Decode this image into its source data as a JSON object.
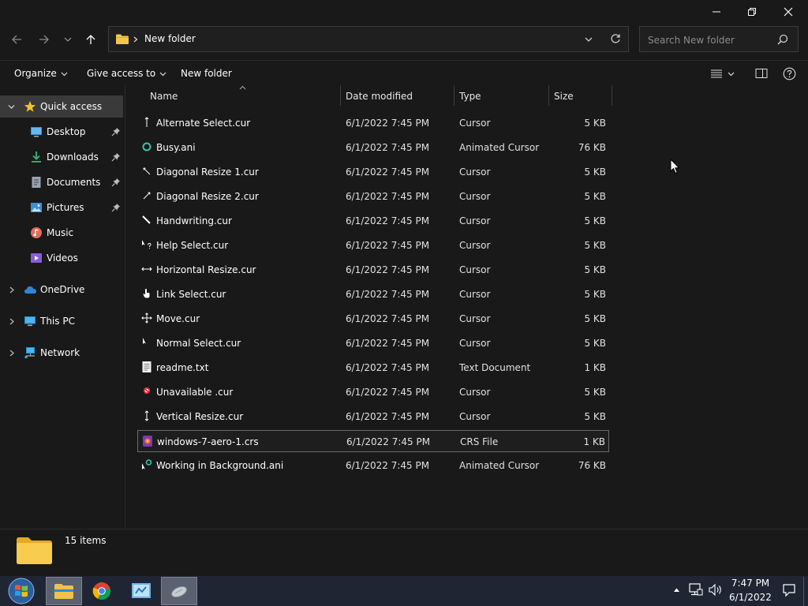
{
  "address": {
    "path": "New folder"
  },
  "search": {
    "placeholder": "Search New folder"
  },
  "commands": {
    "organize": "Organize",
    "give_access": "Give access to",
    "new_folder": "New folder"
  },
  "nav": {
    "quick_access": "Quick access",
    "items": [
      "Desktop",
      "Downloads",
      "Documents",
      "Pictures",
      "Music",
      "Videos"
    ],
    "onedrive": "OneDrive",
    "thispc": "This PC",
    "network": "Network"
  },
  "columns": {
    "name": "Name",
    "date": "Date modified",
    "type": "Type",
    "size": "Size"
  },
  "files": [
    {
      "name": "Alternate Select.cur",
      "date": "6/1/2022 7:45 PM",
      "type": "Cursor",
      "size": "5 KB"
    },
    {
      "name": "Busy.ani",
      "date": "6/1/2022 7:45 PM",
      "type": "Animated Cursor",
      "size": "76 KB"
    },
    {
      "name": "Diagonal Resize 1.cur",
      "date": "6/1/2022 7:45 PM",
      "type": "Cursor",
      "size": "5 KB"
    },
    {
      "name": "Diagonal Resize 2.cur",
      "date": "6/1/2022 7:45 PM",
      "type": "Cursor",
      "size": "5 KB"
    },
    {
      "name": "Handwriting.cur",
      "date": "6/1/2022 7:45 PM",
      "type": "Cursor",
      "size": "5 KB"
    },
    {
      "name": "Help Select.cur",
      "date": "6/1/2022 7:45 PM",
      "type": "Cursor",
      "size": "5 KB"
    },
    {
      "name": "Horizontal Resize.cur",
      "date": "6/1/2022 7:45 PM",
      "type": "Cursor",
      "size": "5 KB"
    },
    {
      "name": "Link Select.cur",
      "date": "6/1/2022 7:45 PM",
      "type": "Cursor",
      "size": "5 KB"
    },
    {
      "name": "Move.cur",
      "date": "6/1/2022 7:45 PM",
      "type": "Cursor",
      "size": "5 KB"
    },
    {
      "name": "Normal Select.cur",
      "date": "6/1/2022 7:45 PM",
      "type": "Cursor",
      "size": "5 KB"
    },
    {
      "name": "readme.txt",
      "date": "6/1/2022 7:45 PM",
      "type": "Text Document",
      "size": "1 KB"
    },
    {
      "name": "Unavailable .cur",
      "date": "6/1/2022 7:45 PM",
      "type": "Cursor",
      "size": "5 KB"
    },
    {
      "name": "Vertical Resize.cur",
      "date": "6/1/2022 7:45 PM",
      "type": "Cursor",
      "size": "5 KB"
    },
    {
      "name": "windows-7-aero-1.crs",
      "date": "6/1/2022 7:45 PM",
      "type": "CRS File",
      "size": "1 KB"
    },
    {
      "name": "Working in Background.ani",
      "date": "6/1/2022 7:45 PM",
      "type": "Animated Cursor",
      "size": "76 KB"
    }
  ],
  "status": {
    "count": "15 items"
  },
  "clock": {
    "time": "7:47 PM",
    "date": "6/1/2022"
  },
  "colors": {
    "bg": "#191919",
    "selected_nav": "#3a3a3a",
    "folder": "#f3c64b",
    "taskbar": "#1f2533"
  }
}
